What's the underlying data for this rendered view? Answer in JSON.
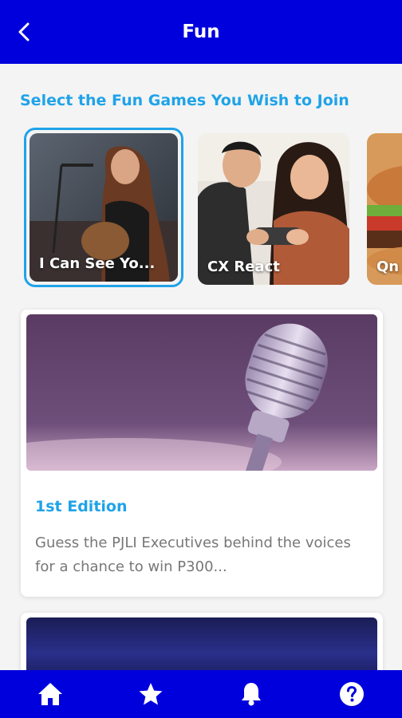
{
  "header": {
    "title": "Fun",
    "back_icon": "chevron-left-icon"
  },
  "section": {
    "title": "Select the Fun Games You Wish to Join"
  },
  "games": [
    {
      "label": "I Can See Yo...",
      "selected": true
    },
    {
      "label": "CX React",
      "selected": false
    },
    {
      "label": "Qn",
      "selected": false
    }
  ],
  "feature": {
    "title": "1st Edition",
    "description": "Guess the PJLI Executives behind the voices for a chance to win P300..."
  },
  "bottom_nav": {
    "items": [
      {
        "icon": "home-icon"
      },
      {
        "icon": "star-icon"
      },
      {
        "icon": "bell-icon"
      },
      {
        "icon": "help-icon"
      }
    ]
  },
  "colors": {
    "primary": "#0000dc",
    "accent": "#1fa3e8",
    "text_muted": "#777777"
  }
}
